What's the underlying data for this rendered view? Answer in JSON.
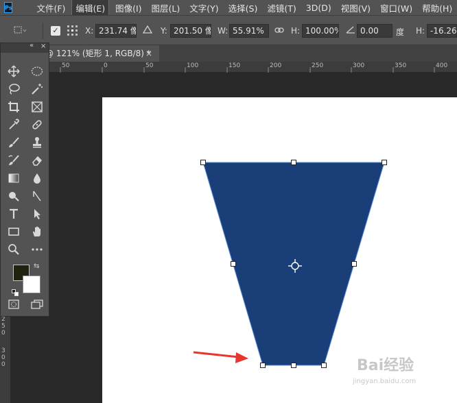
{
  "app": {
    "logo_text": "Ps"
  },
  "menu": {
    "items": [
      "文件(F)",
      "编辑(E)",
      "图像(I)",
      "图层(L)",
      "文字(Y)",
      "选择(S)",
      "滤镜(T)",
      "3D(D)",
      "视图(V)",
      "窗口(W)",
      "帮助(H)"
    ],
    "active_index": 1
  },
  "options": {
    "x_label": "X:",
    "x_value": "231.74 像",
    "y_label": "Y:",
    "y_value": "201.50 像",
    "w_label": "W:",
    "w_value": "55.91%",
    "h_label": "H:",
    "h_value": "100.00%",
    "angle_value": "0.00",
    "angle_unit": "度",
    "hskew_label": "H:",
    "hskew_value": "-16.26"
  },
  "document": {
    "tab_title": "@ 121% (矩形 1, RGB/8) *",
    "close_symbol": "×"
  },
  "ruler": {
    "top_ticks": [
      "50",
      "0",
      "50",
      "100",
      "150",
      "200",
      "250",
      "300",
      "350",
      "400"
    ],
    "left_ticks": [
      "2",
      "5",
      "0",
      "3",
      "0",
      "0"
    ]
  },
  "shape": {
    "fill_color": "#1a3f78"
  },
  "colors": {
    "foreground": "#1f2410",
    "background": "#ffffff",
    "arrow": "#e8352e"
  },
  "watermark": {
    "text": "Bai经验",
    "sub": "jingyan.baidu.com"
  }
}
